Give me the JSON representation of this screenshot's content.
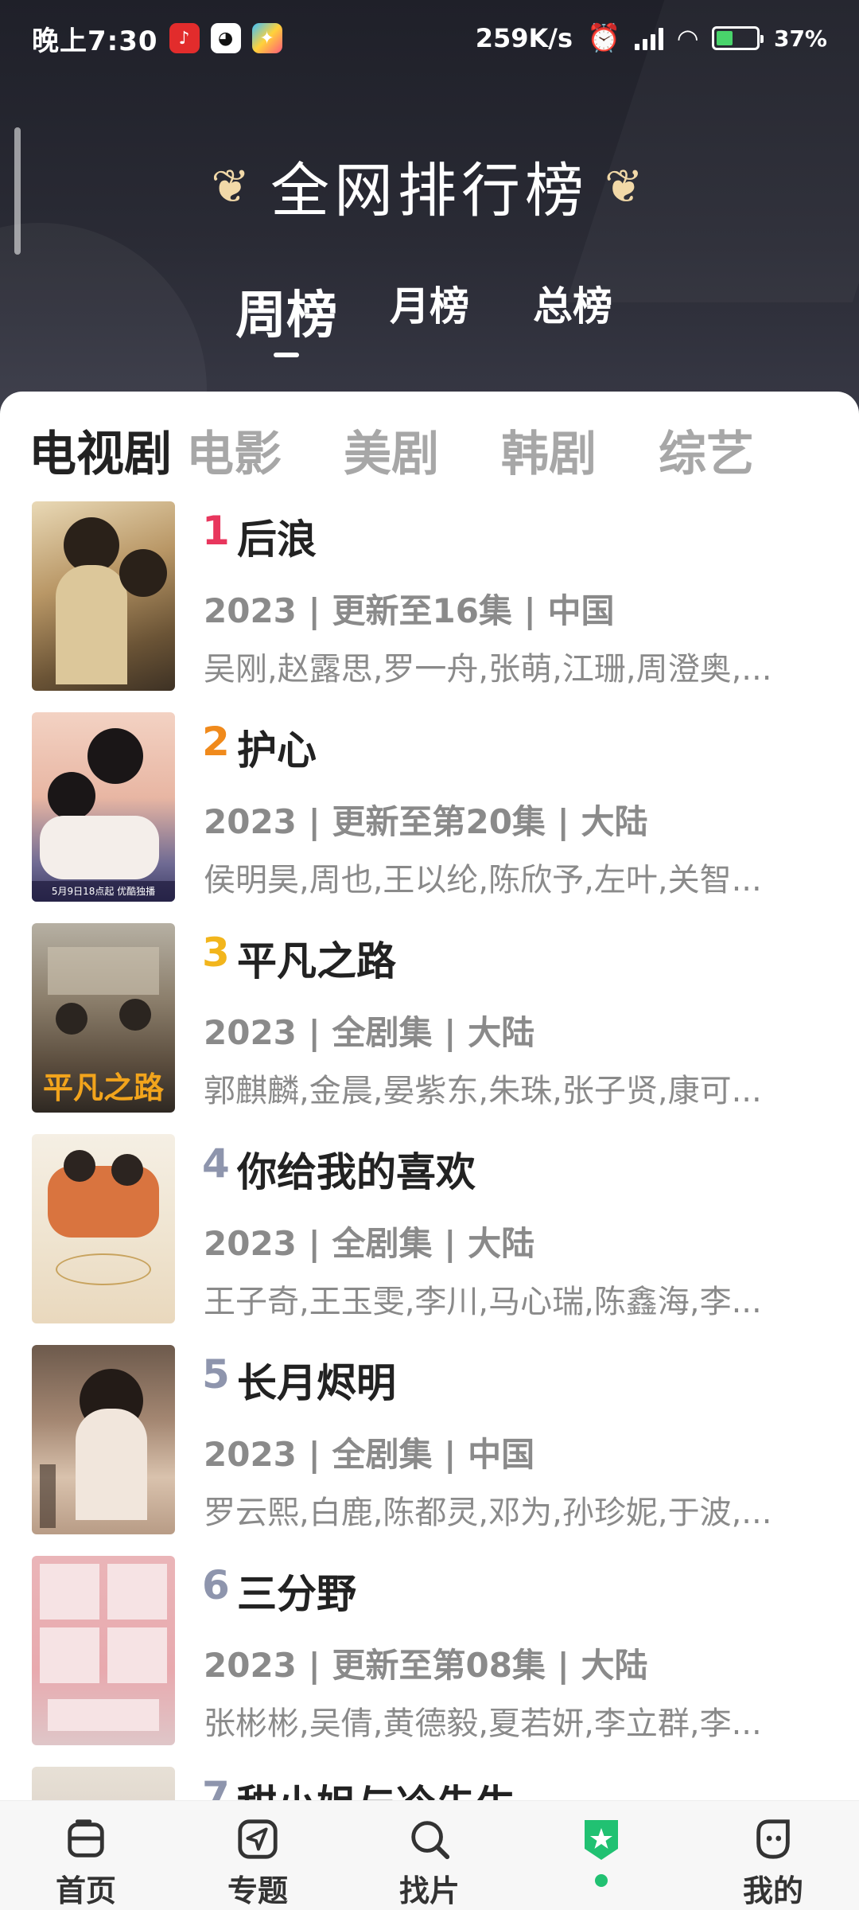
{
  "status_bar": {
    "time": "晚上7:30",
    "network_speed": "259K/s",
    "battery": "37%",
    "apps": [
      "netease-music-icon",
      "qq-icon",
      "puzzle-app-icon"
    ]
  },
  "header": {
    "title": "全网排行榜",
    "period_tabs": [
      "周榜",
      "月榜",
      "总榜"
    ],
    "active_period": "周榜"
  },
  "categories": {
    "tabs": [
      "电视剧",
      "电影",
      "美剧",
      "韩剧",
      "综艺"
    ],
    "active": "电视剧"
  },
  "rank_colors": [
    "#e8365d",
    "#f08a1c",
    "#f2b51c",
    "#8e95ad",
    "#8e95ad",
    "#8e95ad",
    "#8e95ad"
  ],
  "list": [
    {
      "rank": "1",
      "title": "后浪",
      "meta": "2023 | 更新至16集 | 中国",
      "cast": "吴刚,赵露思,罗一舟,张萌,江珊,周澄奥,..."
    },
    {
      "rank": "2",
      "title": "护心",
      "meta": "2023 | 更新至第20集 | 大陆",
      "cast": "侯明昊,周也,王以纶,陈欣予,左叶,关智..."
    },
    {
      "rank": "3",
      "title": "平凡之路",
      "meta": "2023 | 全剧集 | 大陆",
      "cast": "郭麒麟,金晨,晏紫东,朱珠,张子贤,康可..."
    },
    {
      "rank": "4",
      "title": "你给我的喜欢",
      "meta": "2023 | 全剧集 | 大陆",
      "cast": "王子奇,王玉雯,李川,马心瑞,陈鑫海,李..."
    },
    {
      "rank": "5",
      "title": "长月烬明",
      "meta": "2023 | 全剧集 | 中国",
      "cast": "罗云熙,白鹿,陈都灵,邓为,孙珍妮,于波,..."
    },
    {
      "rank": "6",
      "title": "三分野",
      "meta": "2023 | 更新至第08集 | 大陆",
      "cast": "张彬彬,吴倩,黄德毅,夏若妍,李立群,李..."
    },
    {
      "rank": "7",
      "title": "甜小姐与冷先生",
      "meta": "",
      "cast": ""
    }
  ],
  "poster_text": {
    "p2_caption": "5月9日18点起 优酷独播",
    "p3_title": "平凡之路"
  },
  "bottom_nav": [
    {
      "label": "首页",
      "icon": "home-icon"
    },
    {
      "label": "专题",
      "icon": "topic-icon"
    },
    {
      "label": "找片",
      "icon": "search-icon"
    },
    {
      "label": "",
      "icon": "ranking-star-icon"
    },
    {
      "label": "我的",
      "icon": "profile-icon"
    }
  ]
}
